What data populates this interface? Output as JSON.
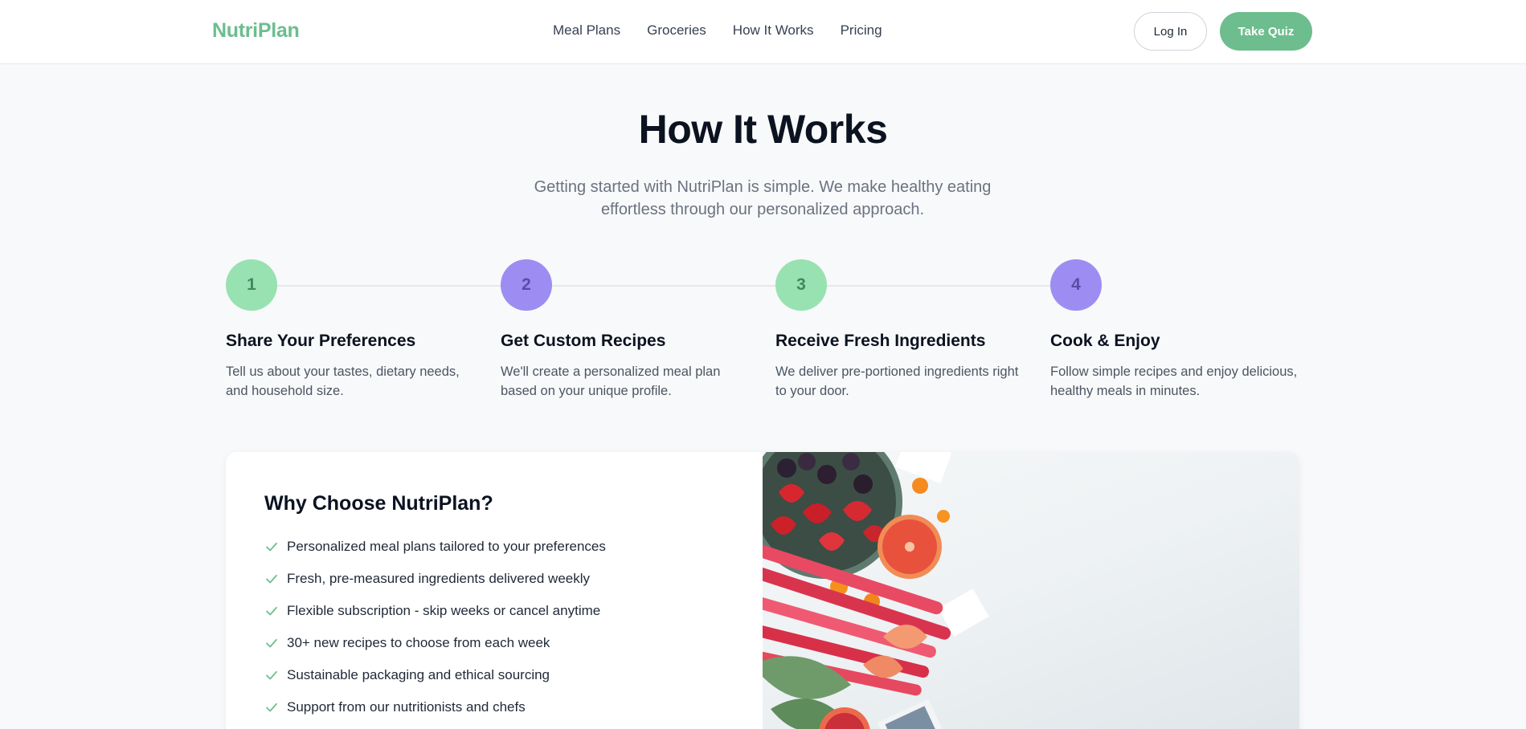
{
  "brand": {
    "name": "NutriPlan",
    "color": "#6dbd8e"
  },
  "nav": {
    "items": [
      {
        "label": "Meal Plans"
      },
      {
        "label": "Groceries"
      },
      {
        "label": "How It Works"
      },
      {
        "label": "Pricing"
      }
    ],
    "login_label": "Log In",
    "quiz_label": "Take Quiz"
  },
  "hero": {
    "title": "How It Works",
    "subtitle": "Getting started with NutriPlan is simple. We make healthy eating effortless through our personalized approach."
  },
  "steps": [
    {
      "number": "1",
      "title": "Share Your Preferences",
      "description": "Tell us about your tastes, dietary needs, and household size.",
      "color": "#98e2b1"
    },
    {
      "number": "2",
      "title": "Get Custom Recipes",
      "description": "We'll create a personalized meal plan based on your unique profile.",
      "color": "#9d8df2"
    },
    {
      "number": "3",
      "title": "Receive Fresh Ingredients",
      "description": "We deliver pre-portioned ingredients right to your door.",
      "color": "#98e2b1"
    },
    {
      "number": "4",
      "title": "Cook & Enjoy",
      "description": "Follow simple recipes and enjoy delicious, healthy meals in minutes.",
      "color": "#9d8df2"
    }
  ],
  "why": {
    "title": "Why Choose NutriPlan?",
    "check_icon": "check-icon",
    "features": [
      "Personalized meal plans tailored to your preferences",
      "Fresh, pre-measured ingredients delivered weekly",
      "Flexible subscription - skip weeks or cancel anytime",
      "30+ new recipes to choose from each week",
      "Sustainable packaging and ethical sourcing",
      "Support from our nutritionists and chefs"
    ]
  }
}
